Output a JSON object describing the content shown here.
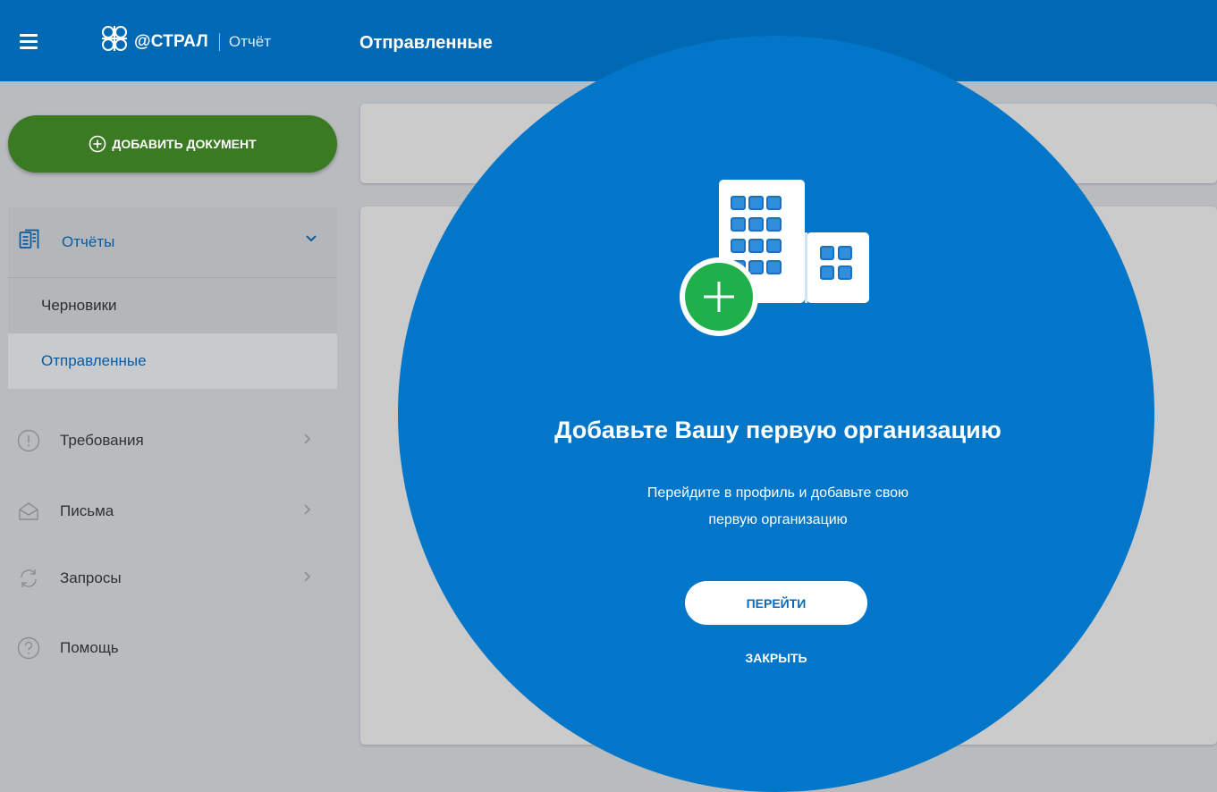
{
  "header": {
    "brand": "@СТРАЛ",
    "product": "Отчёт",
    "title": "Отправленные"
  },
  "sidebar": {
    "add_button_label": "ДОБАВИТЬ ДОКУМЕНТ",
    "reports": {
      "label": "Отчёты",
      "subitems": [
        {
          "label": "Черновики",
          "active": false
        },
        {
          "label": "Отправленные",
          "active": true
        }
      ]
    },
    "items": [
      {
        "label": "Требования",
        "icon": "alert-circle-icon"
      },
      {
        "label": "Письма",
        "icon": "envelope-open-icon"
      },
      {
        "label": "Запросы",
        "icon": "refresh-icon"
      },
      {
        "label": "Помощь",
        "icon": "help-circle-icon"
      }
    ]
  },
  "onboarding": {
    "title": "Добавьте Вашу первую организацию",
    "description_line1": "Перейдите в профиль и добавьте свою",
    "description_line2": "первую организацию",
    "go_button": "ПЕРЕЙТИ",
    "close_button": "ЗАКРЫТЬ"
  },
  "colors": {
    "header_bg": "#0069b3",
    "add_button_bg": "#3a7a22",
    "overlay_circle": "#0276c9",
    "accent_text": "#0a5aa0",
    "plus_badge": "#1fb04c"
  }
}
